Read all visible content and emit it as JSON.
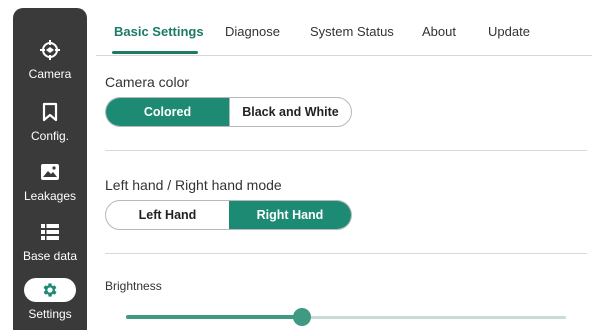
{
  "sidebar": {
    "items": [
      {
        "label": "Camera",
        "icon": "crosshair-icon",
        "active": false
      },
      {
        "label": "Config.",
        "icon": "bookmark-icon",
        "active": false
      },
      {
        "label": "Leakages",
        "icon": "image-icon",
        "active": false
      },
      {
        "label": "Base data",
        "icon": "list-icon",
        "active": false
      },
      {
        "label": "Settings",
        "icon": "gear-icon",
        "active": true
      }
    ]
  },
  "tabs": [
    {
      "label": "Basic Settings",
      "active": true
    },
    {
      "label": "Diagnose",
      "active": false
    },
    {
      "label": "System Status",
      "active": false
    },
    {
      "label": "About",
      "active": false
    },
    {
      "label": "Update",
      "active": false
    }
  ],
  "camera_color": {
    "title": "Camera color",
    "options": [
      "Colored",
      "Black and White"
    ],
    "selected": "Colored"
  },
  "hand_mode": {
    "title": "Left hand / Right hand mode",
    "options": [
      "Left Hand",
      "Right Hand"
    ],
    "selected": "Right Hand"
  },
  "brightness": {
    "title": "Brightness",
    "value_fraction": 0.4
  },
  "colors": {
    "accent": "#1d8a73",
    "tab_accent": "#1d7a67",
    "sidebar_bg": "#3a3a3a",
    "slider": "#3e9a83"
  }
}
